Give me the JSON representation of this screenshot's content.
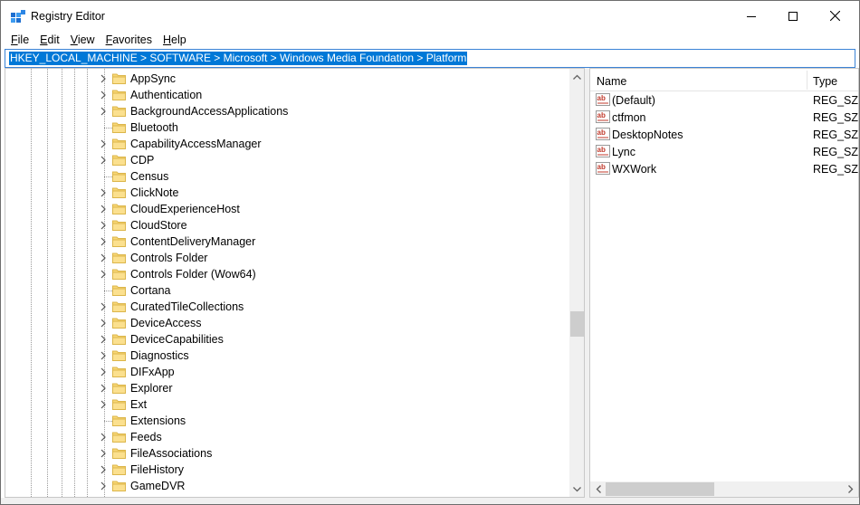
{
  "window": {
    "title": "Registry Editor",
    "app_icon": "registry-editor-icon",
    "controls": {
      "minimize_icon": "minimize-icon",
      "maximize_icon": "maximize-icon",
      "close_icon": "close-icon"
    }
  },
  "menu": [
    {
      "label_u": "F",
      "label_rest": "ile"
    },
    {
      "label_u": "E",
      "label_rest": "dit"
    },
    {
      "label_u": "V",
      "label_rest": "iew"
    },
    {
      "label_u": "F",
      "label_rest": "avorites",
      "prefix": ""
    },
    {
      "label_u": "H",
      "label_rest": "elp"
    }
  ],
  "menu_labels": [
    "File",
    "Edit",
    "View",
    "Favorites",
    "Help"
  ],
  "address": {
    "path": "HKEY_LOCAL_MACHINE > SOFTWARE > Microsoft > Windows Media Foundation > Platform",
    "selected": true
  },
  "tree": {
    "items": [
      {
        "label": "AppSync",
        "expandable": true
      },
      {
        "label": "Authentication",
        "expandable": true
      },
      {
        "label": "BackgroundAccessApplications",
        "expandable": true
      },
      {
        "label": "Bluetooth",
        "expandable": false
      },
      {
        "label": "CapabilityAccessManager",
        "expandable": true
      },
      {
        "label": "CDP",
        "expandable": true
      },
      {
        "label": "Census",
        "expandable": false
      },
      {
        "label": "ClickNote",
        "expandable": true
      },
      {
        "label": "CloudExperienceHost",
        "expandable": true
      },
      {
        "label": "CloudStore",
        "expandable": true
      },
      {
        "label": "ContentDeliveryManager",
        "expandable": true
      },
      {
        "label": "Controls Folder",
        "expandable": true
      },
      {
        "label": "Controls Folder (Wow64)",
        "expandable": true
      },
      {
        "label": "Cortana",
        "expandable": false
      },
      {
        "label": "CuratedTileCollections",
        "expandable": true
      },
      {
        "label": "DeviceAccess",
        "expandable": true
      },
      {
        "label": "DeviceCapabilities",
        "expandable": true
      },
      {
        "label": "Diagnostics",
        "expandable": true
      },
      {
        "label": "DIFxApp",
        "expandable": true
      },
      {
        "label": "Explorer",
        "expandable": true
      },
      {
        "label": "Ext",
        "expandable": true
      },
      {
        "label": "Extensions",
        "expandable": false
      },
      {
        "label": "Feeds",
        "expandable": true
      },
      {
        "label": "FileAssociations",
        "expandable": true
      },
      {
        "label": "FileHistory",
        "expandable": true
      },
      {
        "label": "GameDVR",
        "expandable": true
      }
    ],
    "folder_icon": "folder-icon",
    "expand_icon": "chevron-right-icon"
  },
  "values": {
    "columns": {
      "name": "Name",
      "type": "Type"
    },
    "rows": [
      {
        "name": "(Default)",
        "type": "REG_SZ",
        "icon": "string-value-icon"
      },
      {
        "name": "ctfmon",
        "type": "REG_SZ",
        "icon": "string-value-icon"
      },
      {
        "name": "DesktopNotes",
        "type": "REG_SZ",
        "icon": "string-value-icon"
      },
      {
        "name": "Lync",
        "type": "REG_SZ",
        "icon": "string-value-icon"
      },
      {
        "name": "WXWork",
        "type": "REG_SZ",
        "icon": "string-value-icon"
      }
    ]
  },
  "colors": {
    "selection": "#0078d7",
    "folder": "#f8d775",
    "folder_edge": "#dcb64a",
    "string_icon_red": "#c0392b"
  }
}
